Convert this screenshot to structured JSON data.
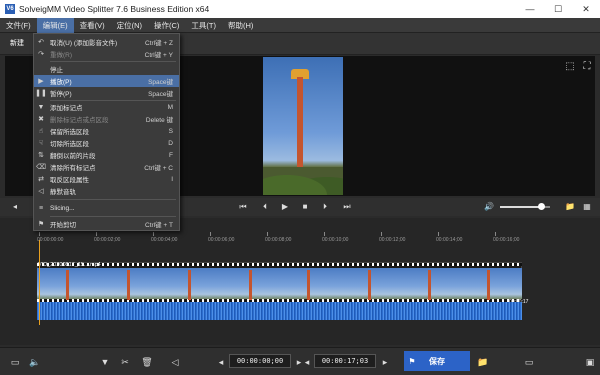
{
  "window": {
    "title": "SolveigMM Video Splitter 7.6 Business Edition x64",
    "icon_text": "V6"
  },
  "menubar": [
    "文件(F)",
    "编辑(E)",
    "查看(V)",
    "定位(N)",
    "操作(C)",
    "工具(T)",
    "帮助(H)"
  ],
  "toolbar": {
    "tab_left": "新建"
  },
  "edit_menu": [
    {
      "label": "取消(U) (添加影音文件)",
      "key": "Ctrl键 + Z",
      "disabled": false
    },
    {
      "label": "重做(R)",
      "key": "Ctrl键 + Y",
      "disabled": true
    },
    {
      "label": "停止",
      "key": "",
      "disabled": false
    },
    {
      "label": "播放(P)",
      "key": "Space键",
      "disabled": false,
      "highlight": true
    },
    {
      "label": "暂停(P)",
      "key": "Space键",
      "disabled": false
    },
    {
      "label": "添加标记点",
      "key": "M",
      "disabled": false
    },
    {
      "label": "删除标记点或点区段",
      "key": "Delete 键",
      "disabled": true
    },
    {
      "label": "保留所选区段",
      "key": "S",
      "disabled": false
    },
    {
      "label": "切除所选区段",
      "key": "D",
      "disabled": false
    },
    {
      "label": "翻倒以前的片段",
      "key": "F",
      "disabled": false
    },
    {
      "label": "清除所有标记点",
      "key": "Ctrl键 + C",
      "disabled": false
    },
    {
      "label": "取反区段属性",
      "key": "I",
      "disabled": false
    },
    {
      "label": "静默音轨",
      "key": "",
      "disabled": false
    },
    {
      "label": "Slicing...",
      "key": "",
      "disabled": false
    },
    {
      "label": "开始剪切",
      "key": "Ctrl键 + T",
      "disabled": false
    }
  ],
  "timeline": {
    "ruler_labels": [
      "00:00:00:00",
      "00:00:02;00",
      "00:00:04;00",
      "00:00:06;00",
      "00:00:08;00",
      "00:00:10;00",
      "00:00:12;00",
      "00:00:14;00",
      "00:00:16;00"
    ],
    "clip_name": "VID_20200817_15....mp4",
    "clip_end_time": "00:00:17"
  },
  "volume": {
    "level": 0.82
  },
  "bottom": {
    "start_time": "00:00:00;00",
    "end_time": "00:00:17;03",
    "save_label": "保存"
  }
}
